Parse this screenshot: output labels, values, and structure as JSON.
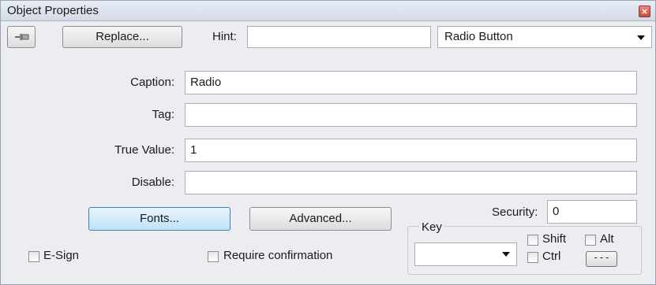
{
  "window": {
    "title": "Object Properties",
    "close_icon": "close-icon"
  },
  "toolbar": {
    "pin_icon": "pin-icon",
    "replace_label": "Replace...",
    "hint_label": "Hint:",
    "hint_value": "",
    "type_select": "Radio Button"
  },
  "fields": {
    "caption_label": "Caption:",
    "caption_value": "Radio",
    "tag_label": "Tag:",
    "tag_value": "",
    "true_value_label": "True Value:",
    "true_value_value": "1",
    "disable_label": "Disable:",
    "disable_value": ""
  },
  "buttons": {
    "fonts_label": "Fonts...",
    "advanced_label": "Advanced..."
  },
  "security": {
    "label": "Security:",
    "value": "0"
  },
  "key": {
    "group_label": "Key",
    "select_value": "",
    "shift_label": "Shift",
    "alt_label": "Alt",
    "ctrl_label": "Ctrl",
    "more_label": "---"
  },
  "options": {
    "esign_label": "E-Sign",
    "require_confirmation_label": "Require confirmation"
  }
}
